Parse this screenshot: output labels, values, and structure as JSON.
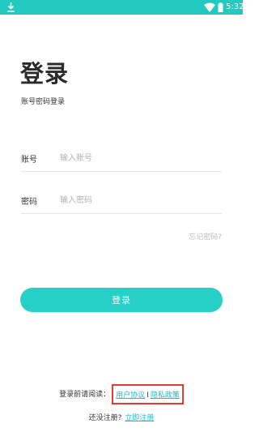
{
  "status_bar": {
    "time": "5:32",
    "icons": [
      "download-icon",
      "wifi-icon",
      "battery-icon"
    ],
    "background": "#21c9bf"
  },
  "page": {
    "title": "登录",
    "subtitle": "账号密码登录"
  },
  "form": {
    "account": {
      "label": "账号",
      "placeholder": "输入账号",
      "value": ""
    },
    "password": {
      "label": "密码",
      "placeholder": "输入密码",
      "value": ""
    },
    "forgot": "忘记密码?",
    "submit": "登录",
    "accent": "#26d0c7"
  },
  "agreement": {
    "prefix": "登录前请阅读：",
    "user_agreement": "用户协议",
    "separator": "I",
    "privacy_policy": "隐私政策",
    "highlight_color": "#e53935"
  },
  "register": {
    "prompt": "还没注册?",
    "link": "立即注册"
  }
}
